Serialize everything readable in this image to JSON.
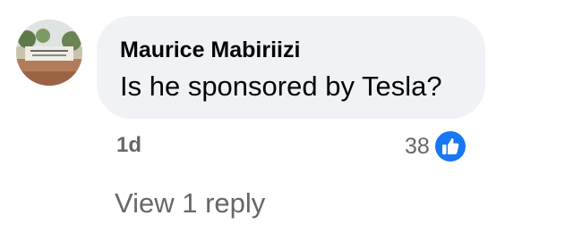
{
  "comment": {
    "author": "Maurice Mabiriizi",
    "text": "Is he sponsored by Tesla?",
    "time": "1d",
    "reaction_count": "38",
    "reaction_icon": "like-icon",
    "view_replies_label": "View 1 reply"
  },
  "colors": {
    "bubble_background": "#f0f2f5",
    "secondary_text": "#65676b",
    "like_blue": "#1877f2"
  }
}
